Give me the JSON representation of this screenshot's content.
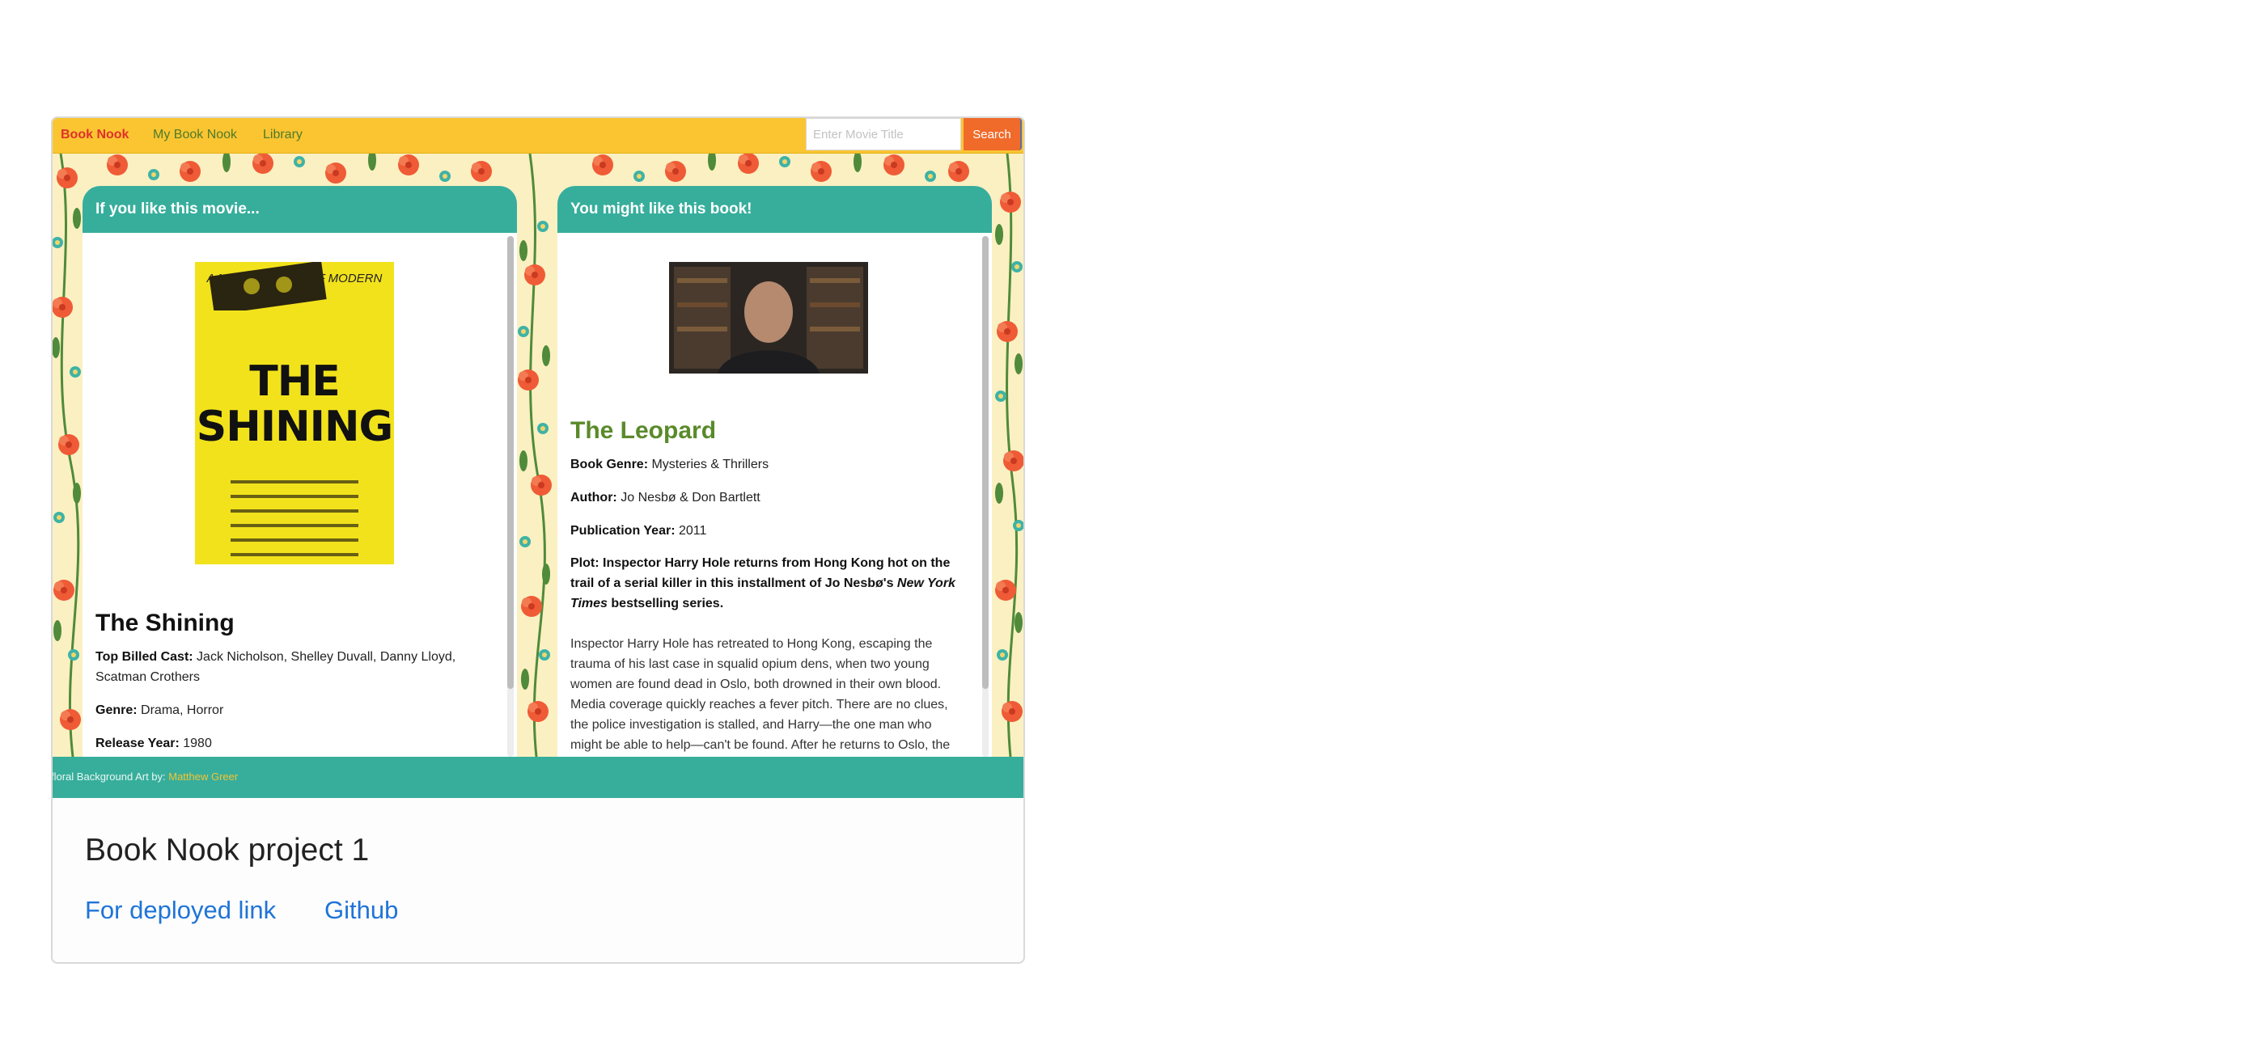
{
  "navbar": {
    "brand": "Book Nook",
    "links": [
      "My Book Nook",
      "Library"
    ],
    "search_placeholder": "Enter Movie Title",
    "search_button": "Search"
  },
  "movie_card": {
    "header": "If you like this movie...",
    "poster": {
      "tagline": "A MASTERPIECE OF MODERN HORROR",
      "title": "THE SHINING"
    },
    "title": "The Shining",
    "cast_label": "Top Billed Cast:",
    "cast_value": "Jack Nicholson, Shelley Duvall, Danny Lloyd, Scatman Crothers",
    "genre_label": "Genre:",
    "genre_value": "Drama, Horror",
    "year_label": "Release Year:",
    "year_value": "1980"
  },
  "book_card": {
    "header": "You might like this book!",
    "title": "The Leopard",
    "genre_label": "Book Genre:",
    "genre_value": "Mysteries & Thrillers",
    "author_label": "Author:",
    "author_value": "Jo Nesbø & Don Bartlett",
    "pubyear_label": "Publication Year:",
    "pubyear_value": "2011",
    "plot_prefix": "Plot: Inspector Harry Hole returns from Hong Kong hot on the trail of a serial killer in this installment of Jo Nesbø's ",
    "plot_italic": "New York Times",
    "plot_suffix": " bestselling series.",
    "plot_text": "Inspector Harry Hole has retreated to Hong Kong, escaping the trauma of his last case in squalid opium dens, when two young women are found dead in Oslo, both drowned in their own blood. Media coverage quickly reaches a fever pitch. There are no clues, the police investigation is stalled, and Harry—the one man who might be able to help—can't be found. After he returns to Oslo, the killer strikes"
  },
  "footer": {
    "credit_prefix": "floral Background Art by: ",
    "credit_link": "Matthew Greer"
  },
  "project": {
    "title": "Book Nook project 1",
    "deploy_link": "For deployed link",
    "github_link": "Github"
  },
  "colors": {
    "navbar": "#fbc531",
    "brand": "#e0312b",
    "nav_link": "#4e7a2a",
    "search_button": "#f06a2a",
    "teal": "#37ae9c",
    "book_title": "#5a8a2a",
    "link": "#1f74d8",
    "floral_bg": "#fbf0c2"
  }
}
